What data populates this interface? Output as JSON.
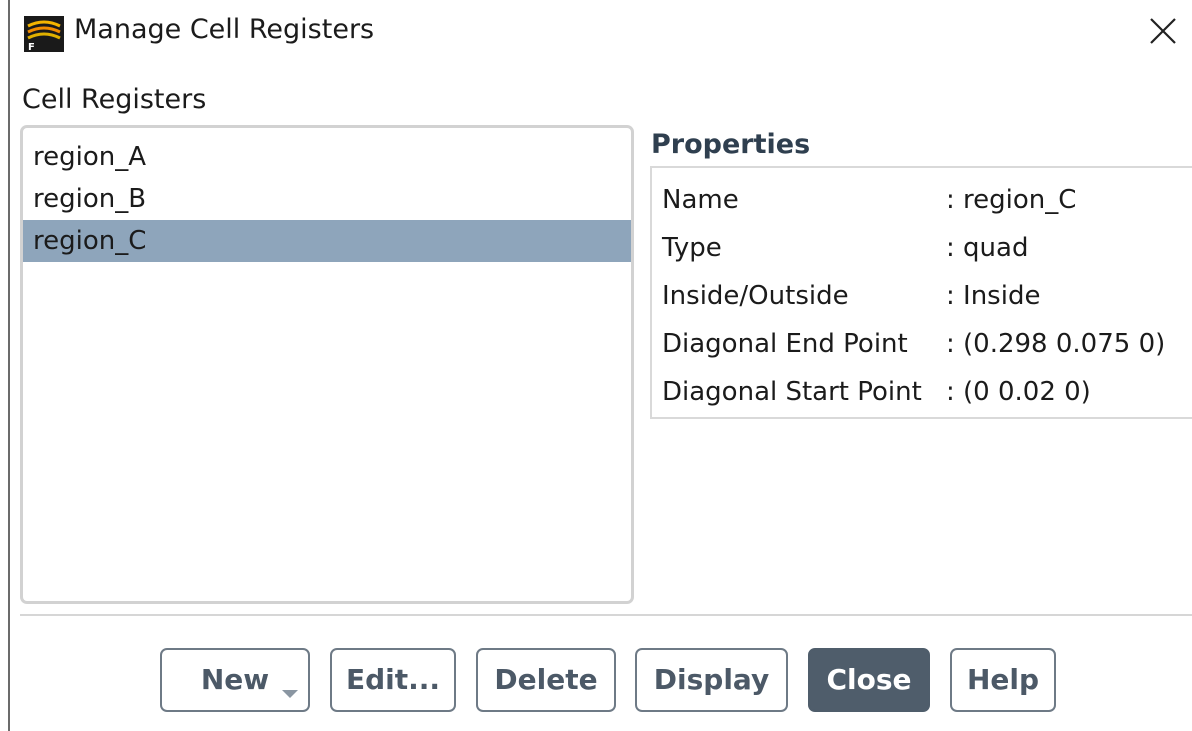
{
  "window": {
    "title": "Manage Cell Registers"
  },
  "registers": {
    "label": "Cell Registers",
    "items": [
      {
        "label": "region_A",
        "selected": false
      },
      {
        "label": "region_B",
        "selected": false
      },
      {
        "label": "region_C",
        "selected": true
      }
    ]
  },
  "properties": {
    "title": "Properties",
    "rows": [
      {
        "key": "Name",
        "value": ": region_C"
      },
      {
        "key": "Type",
        "value": ": quad"
      },
      {
        "key": "Inside/Outside",
        "value": ": Inside"
      },
      {
        "key": "Diagonal End Point",
        "value": ": (0.298 0.075 0)"
      },
      {
        "key": "Diagonal Start Point",
        "value": ": (0 0.02 0)"
      }
    ]
  },
  "buttons": {
    "new": "New",
    "edit": "Edit...",
    "delete": "Delete",
    "display": "Display",
    "close": "Close",
    "help": "Help"
  },
  "colors": {
    "selection": "#8ea5bb",
    "primary_button": "#4f5d6b",
    "button_text": "#4c5967"
  },
  "icons": {
    "app": "fluent-app-icon",
    "close": "close-icon",
    "dropdown": "dropdown-arrow-icon"
  }
}
